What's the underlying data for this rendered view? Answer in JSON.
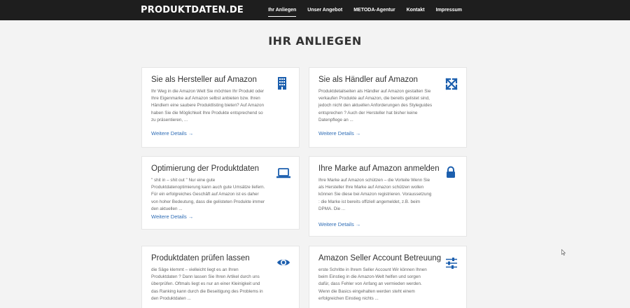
{
  "header": {
    "logo": "PRODUKTDATEN.DE",
    "nav": [
      {
        "label": "Ihr Anliegen",
        "active": true
      },
      {
        "label": "Unser Angebot"
      },
      {
        "label": "METODA-Agentur"
      },
      {
        "label": "Kontakt"
      },
      {
        "label": "Impressum"
      }
    ]
  },
  "page_title": "IHR ANLIEGEN",
  "cards": [
    {
      "title": "Sie als Hersteller auf Amazon",
      "icon": "building-icon",
      "text": "Ihr Weg in die Amazon Welt Sie möchten Ihr Produkt oder Ihre Eigenmarke auf Amazon selbst anbieten bzw. Ihren Händlern eine saubere Produktlisting bieten? Auf Amazon haben Sie die Möglichkeit Ihre Produkte entsprechend so zu präsentieren, ...",
      "link": "Weitere Details →"
    },
    {
      "title": "Sie als Händler auf Amazon",
      "icon": "expand-arrows-icon",
      "text": "Produktdetailseiten als Händler auf Amazon gestalten Sie verkaufen Produkte auf Amazon, die bereits gelistet sind, jedoch nicht den aktuellen Anforderungen des Styleguides entsprechen ? Auch der Hersteller hat bisher keine Datenpflege an ...",
      "link": "Weitere Details →"
    },
    {
      "title": "Optimierung der Produktdaten",
      "icon": "laptop-icon",
      "text": "\" shit in – shit out \" Nur eine gute Produktdatenoptimierung kann auch gute Umsätze liefern. Für ein erfolgreiches Geschäft auf Amazon ist es daher von hoher Bedeutung, dass die gelisteten Produkte immer den aktuellen ...",
      "link": "Weitere Details →"
    },
    {
      "title": "Ihre Marke auf Amazon anmelden",
      "icon": "lock-icon",
      "text": "Ihre Marke auf Amazon schützen – die Vorteile Wenn Sie als Hersteller Ihre Marke auf Amazon schützen wollen können Sie diese bei Amazon registrieren. Voraussetzung : die Marke ist bereits offiziell angemeldet, z.B. beim DPMA. Die ...",
      "link": "Weitere Details →"
    },
    {
      "title": "Produktdaten prüfen lassen",
      "icon": "eye-icon",
      "text": "die Säge klemmt – vielleicht liegt es an Ihren Produktdaten ? Dann lassen Sie Ihren Artikel durch uns überprüfen. Oftmals liegt es nur an einer Kleinigkeit und das Ranking kann durch die Beseitigung des Problems in den Produktdaten ...",
      "link": ""
    },
    {
      "title": "Amazon Seller Account Betreuung",
      "icon": "sliders-icon",
      "text": "erste Schritte in Ihrem Seller Account  Wir können Ihnen beim Einstieg in die Amazon-Welt helfen und sorgen dafür, dass Fehler von Anfang an vermieden werden. Wenn die Basics eingehalten werden steht einem erfolgreichen Einstieg nichts ...",
      "link": ""
    }
  ],
  "colors": {
    "accent": "#1c5fae",
    "link": "#2f6db5",
    "header_bg": "#1e1e1e",
    "page_bg": "#f3f3f3"
  }
}
